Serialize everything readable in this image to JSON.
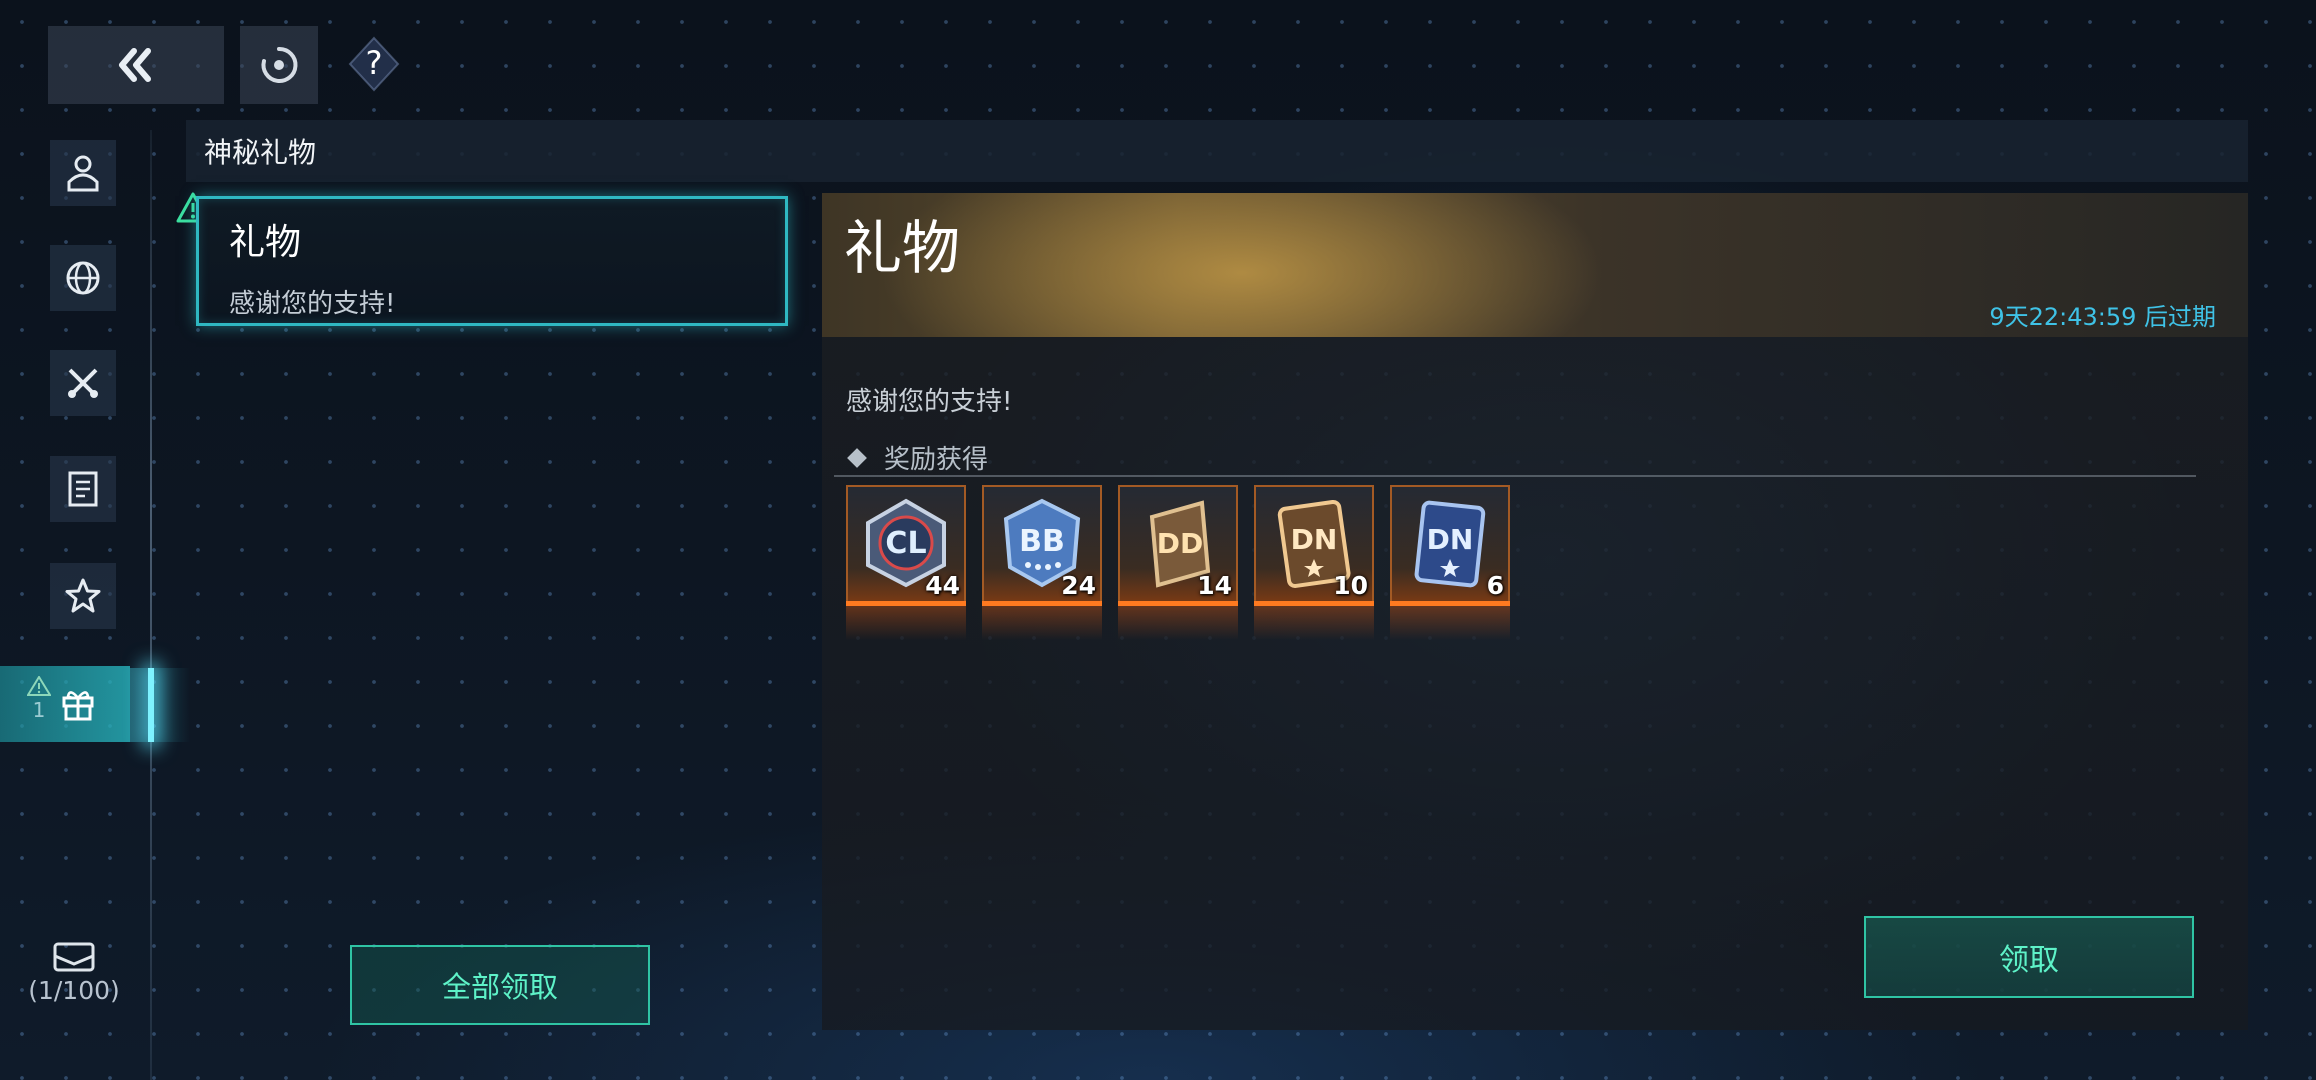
{
  "toolbar": {
    "back_icon": "double-chevron-left-icon",
    "refresh_icon": "refresh-icon",
    "help_label": "?"
  },
  "sidebar": {
    "items": [
      {
        "icon": "person-icon"
      },
      {
        "icon": "globe-icon"
      },
      {
        "icon": "crossed-swords-icon"
      },
      {
        "icon": "document-icon"
      },
      {
        "icon": "star-icon"
      },
      {
        "icon": "gift-icon",
        "active": true,
        "badge_count": "1"
      }
    ],
    "mail_count": "(1/100)"
  },
  "header": {
    "title": "神秘礼物"
  },
  "mail_list": [
    {
      "title": "礼物",
      "subtitle": "感谢您的支持!"
    }
  ],
  "claim_all_label": "全部领取",
  "detail": {
    "title": "礼物",
    "expire_text": "9天22:43:59 后过期",
    "body": "感谢您的支持!",
    "rewards_heading": "奖励获得",
    "rewards": [
      {
        "code": "CL",
        "count": "44",
        "style": "silver"
      },
      {
        "code": "BB",
        "count": "24",
        "style": "blue"
      },
      {
        "code": "DD",
        "count": "14",
        "style": "bronze"
      },
      {
        "code": "DN",
        "count": "10",
        "style": "gold"
      },
      {
        "code": "DN",
        "count": "6",
        "style": "navy"
      }
    ],
    "claim_label": "领取"
  },
  "colors": {
    "accent_cyan": "#2fb8c2",
    "accent_green": "#5ef2c8",
    "expire_blue": "#3fc2e6",
    "reward_orange": "#ff7a20"
  }
}
